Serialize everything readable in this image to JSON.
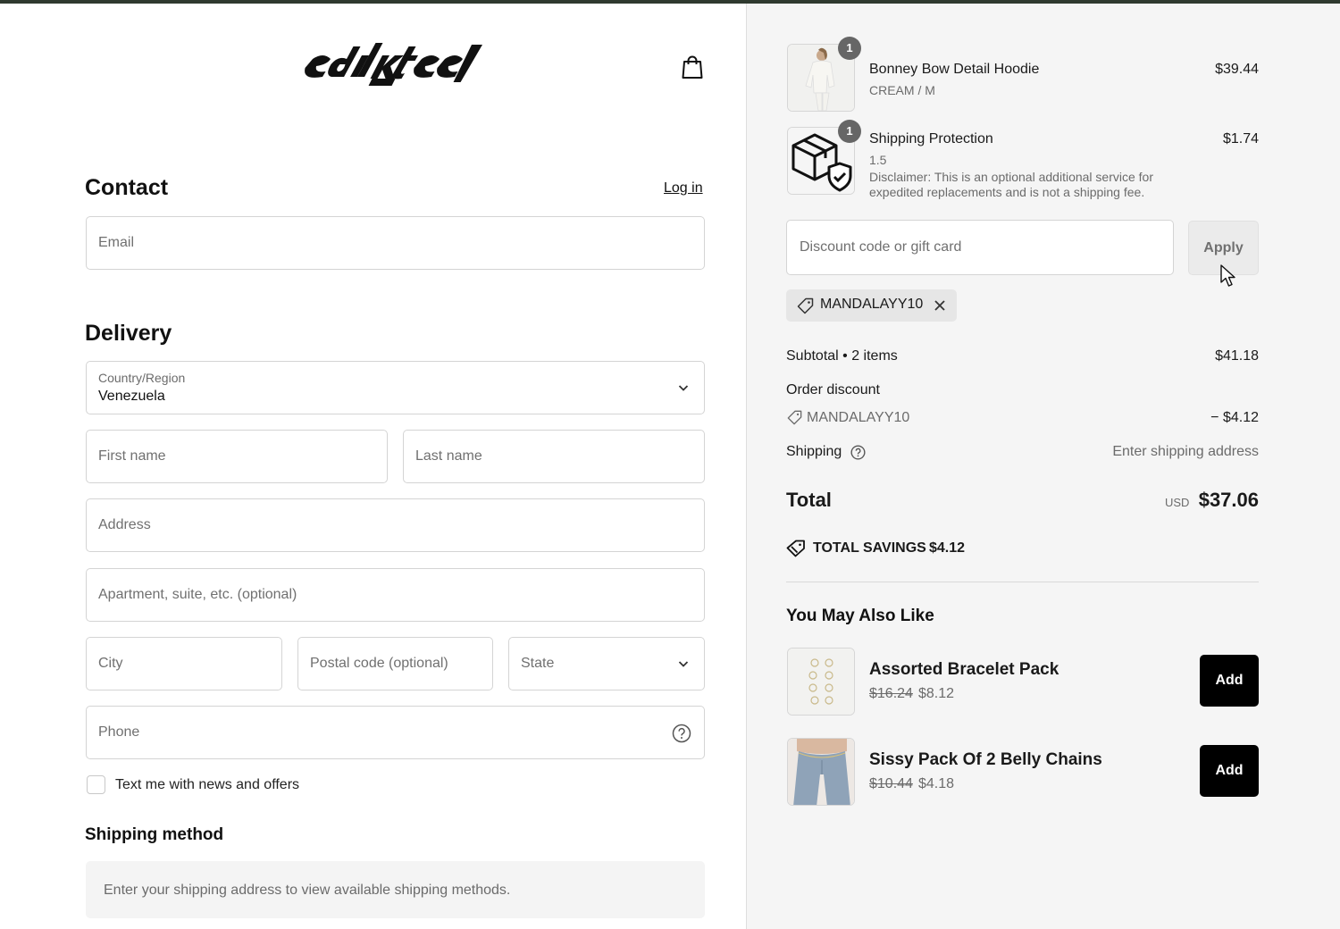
{
  "store": {
    "logo_text": "edikted"
  },
  "contact": {
    "title": "Contact",
    "login_link": "Log in",
    "email_placeholder": "Email"
  },
  "delivery": {
    "title": "Delivery",
    "country_label": "Country/Region",
    "country_value": "Venezuela",
    "first_name_placeholder": "First name",
    "last_name_placeholder": "Last name",
    "address_placeholder": "Address",
    "apartment_placeholder": "Apartment, suite, etc. (optional)",
    "city_placeholder": "City",
    "postal_placeholder": "Postal code (optional)",
    "state_placeholder": "State",
    "phone_placeholder": "Phone",
    "sms_optin_label": "Text me with news and offers"
  },
  "shipping_method": {
    "title": "Shipping method",
    "message": "Enter your shipping address to view available shipping methods."
  },
  "cart": {
    "items": [
      {
        "name": "Bonney Bow Detail Hoodie",
        "variant": "CREAM / M",
        "price": "$39.44",
        "quantity": "1"
      },
      {
        "name": "Shipping Protection",
        "variant": "1.5",
        "disclaimer": "Disclaimer: This is an optional additional service for expedited replacements and is not a shipping fee.",
        "price": "$1.74",
        "quantity": "1"
      }
    ]
  },
  "discount": {
    "placeholder": "Discount code or gift card",
    "apply_label": "Apply",
    "applied_code": "MANDALAYY10"
  },
  "summary": {
    "subtotal_label": "Subtotal • 2 items",
    "subtotal_value": "$41.18",
    "order_discount_label": "Order discount",
    "discount_code": "MANDALAYY10",
    "discount_value": "− $4.12",
    "shipping_label": "Shipping",
    "shipping_value": "Enter shipping address",
    "total_label": "Total",
    "currency": "USD",
    "total_value": "$37.06",
    "savings_label": "TOTAL SAVINGS",
    "savings_value": "$4.12"
  },
  "recommendations": {
    "title": "You May Also Like",
    "items": [
      {
        "name": "Assorted Bracelet Pack",
        "old_price": "$16.24",
        "new_price": "$8.12",
        "add_label": "Add"
      },
      {
        "name": "Sissy Pack Of 2 Belly Chains",
        "old_price": "$10.44",
        "new_price": "$4.18",
        "add_label": "Add"
      }
    ]
  },
  "colors": {
    "accent": "#000000",
    "top_bar": "#2f3a2f",
    "summary_bg": "#f5f5f5"
  }
}
